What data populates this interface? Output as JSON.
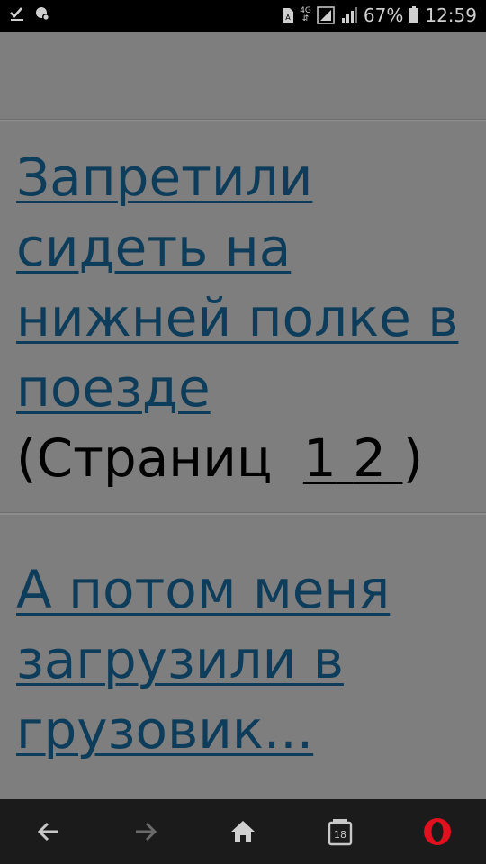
{
  "status_bar": {
    "network_type": "4G",
    "battery_percent": "67%",
    "time": "12:59"
  },
  "topics": [
    {
      "title": ""
    },
    {
      "title_lines": [
        "Запретили",
        "сидеть на",
        "нижней полке в",
        "поезде"
      ],
      "pages_prefix": "(Страниц ",
      "pages": [
        "1",
        "2"
      ],
      "pages_suffix": ")"
    },
    {
      "title_lines": [
        "А потом меня",
        "загрузили в",
        "грузовик..."
      ]
    }
  ],
  "nav": {
    "tab_count": "18",
    "icons": [
      "back-arrow-icon",
      "forward-arrow-icon",
      "home-icon",
      "tabs-icon",
      "opera-logo-icon"
    ]
  },
  "colors": {
    "background": "#7e7e7e",
    "link": "#0d3d5a",
    "nav_bar": "#1b1b1b",
    "opera_red": "#e0101e"
  }
}
